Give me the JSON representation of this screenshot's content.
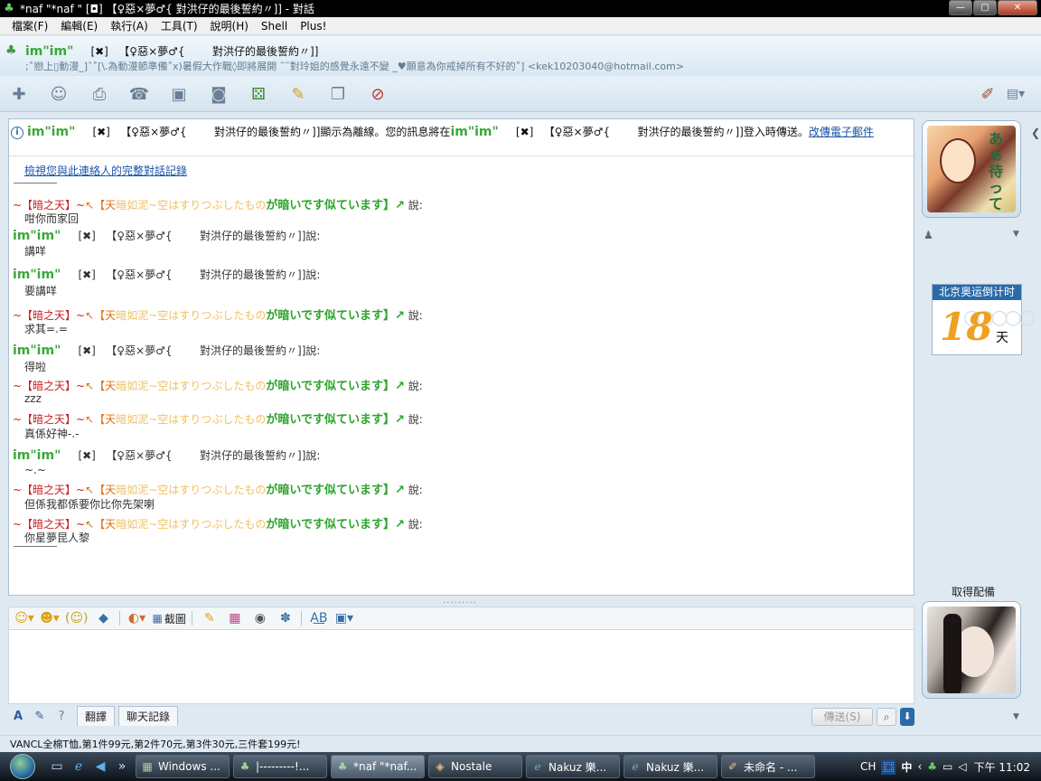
{
  "window": {
    "title": "*naf \"*naf \"     [◘]   【♀惡×夢♂{        對洪仔的最後誓約〃]] - 對話",
    "buttons": {
      "minimize": "—",
      "maximize": "▢",
      "close": "✕"
    }
  },
  "menu": [
    "檔案(F)",
    "編輯(E)",
    "執行(A)",
    "工具(T)",
    "說明(H)",
    "Shell",
    "Plus!"
  ],
  "header": {
    "name_im": "im\"im\"",
    "name_rest": "     [✖]   【♀惡×夢♂{        對洪仔的最後誓約〃]]",
    "personal_message": ";˚戀上▯動漫_]ˇ˚[\\.為動漫節準備˚x)暑假大作戰◊即將展開 ˜˜對玲姐的感覺永遠不變 _♥願意為你戒掉所有不好的˚] <kek10203040@hotmail.com>"
  },
  "toolbar_icons": [
    "invite-icon",
    "contacts-icon",
    "share-files-icon",
    "call-icon",
    "video-icon",
    "webcam-icon",
    "games-icon",
    "activities-icon",
    "documents-icon",
    "block-icon"
  ],
  "info_bar": {
    "prefix_im": "im\"im\"",
    "part1": "     [✖]   【♀惡×夢♂{        對洪仔的最後誓約〃]]顯示為離線。您的訊息將在",
    "mid_im": "im\"im\"",
    "part2": "     [✖]   【♀惡×夢♂{        對洪仔的最後誓約〃]]登入時傳送。",
    "link": "改傳電子郵件"
  },
  "history_link": "檢視您與此連絡人的完整對話記錄",
  "sender_other": {
    "red": "~【暗之天】~",
    "orange": "↖【天",
    "pale": "暗如泥~空はすりつぶしたもの",
    "green": "が暗いです似ています】↗",
    "say": " 說:"
  },
  "sender_me": {
    "im": "im\"im\"",
    "rest": "     [✖]   【♀惡×夢♂{        對洪仔的最後誓約〃]]說:"
  },
  "messages": [
    {
      "from": "other",
      "text": "咁你而家回"
    },
    {
      "from": "me",
      "text": "講咩"
    },
    {
      "from": "me",
      "text": "要講咩"
    },
    {
      "from": "other",
      "text": "求其=.="
    },
    {
      "from": "me",
      "text": "得啦"
    },
    {
      "from": "other",
      "text": "zzz"
    },
    {
      "from": "other",
      "text": "真係好神-.-"
    },
    {
      "from": "me",
      "text": "~.~"
    },
    {
      "from": "other",
      "text": "但係我都係要你比你先架喇"
    },
    {
      "from": "other",
      "text": "你星夢昆人黎"
    }
  ],
  "olympic": {
    "title": "北京奥运倒计时",
    "days": "18",
    "unit": "天"
  },
  "get_avatar": "取得配備",
  "input_toolbar": {
    "screenshot": "截圖"
  },
  "bottom": {
    "translate": "翻譯",
    "history": "聊天記錄",
    "send": "傳送(S)"
  },
  "ad": "VANCL全棉T恤,第1件99元,第2件70元,第3件30元,三件套199元!",
  "taskbar": {
    "tasks": [
      "Windows ...",
      "|---------!...",
      "*naf \"*naf...",
      "Nostale",
      "Nakuz 樂...",
      "Nakuz 樂...",
      "未命名 - ..."
    ],
    "tray": {
      "lang1": "CH",
      "lang2": "中",
      "clock": "下午 11:02"
    }
  },
  "colors": {
    "accent": "#2a6aa8",
    "red_name": "#c81e1e",
    "green_name": "#2aa42a",
    "link": "#1a55a8"
  }
}
